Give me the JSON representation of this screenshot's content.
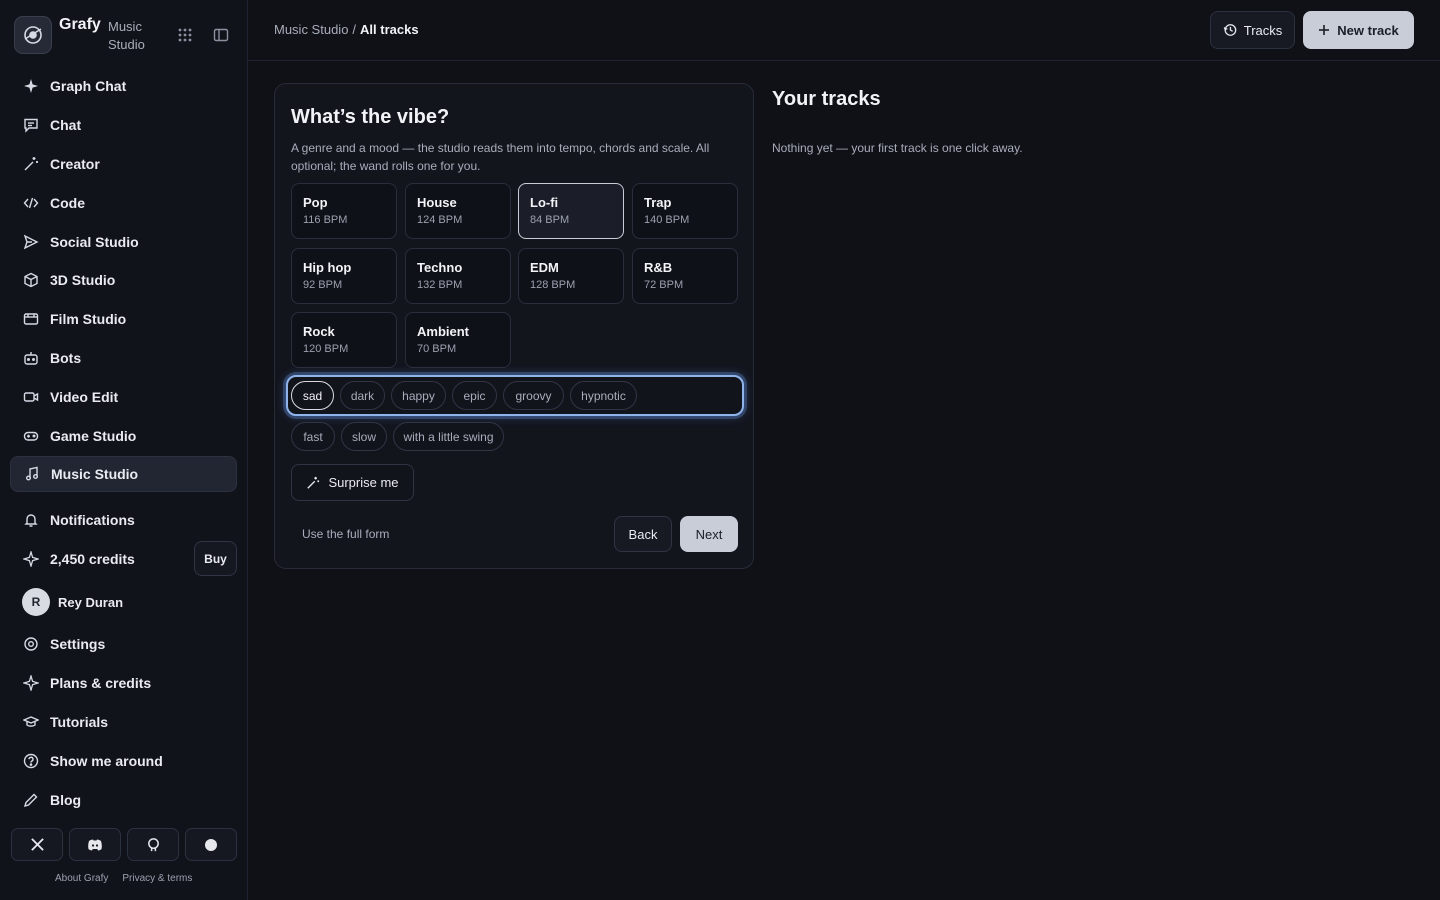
{
  "brand": {
    "name": "Grafy",
    "section": "Music Studio"
  },
  "sidebar": {
    "nav": [
      {
        "label": "Graph Chat",
        "icon": "sparkle-icon"
      },
      {
        "label": "Chat",
        "icon": "chat-icon"
      },
      {
        "label": "Creator",
        "icon": "wand-icon"
      },
      {
        "label": "Code",
        "icon": "code-icon"
      },
      {
        "label": "Social Studio",
        "icon": "send-icon"
      },
      {
        "label": "3D Studio",
        "icon": "cube-icon"
      },
      {
        "label": "Film Studio",
        "icon": "film-icon"
      },
      {
        "label": "Bots",
        "icon": "bot-icon"
      },
      {
        "label": "Video Edit",
        "icon": "video-icon"
      },
      {
        "label": "Game Studio",
        "icon": "gamepad-icon"
      },
      {
        "label": "Music Studio",
        "icon": "music-icon",
        "active": true
      }
    ],
    "notifications": "Notifications",
    "credits": "2,450 credits",
    "buy": "Buy",
    "user": {
      "initial": "R",
      "name": "Rey Duran"
    },
    "bottom": [
      {
        "label": "Settings",
        "icon": "gear-icon"
      },
      {
        "label": "Plans & credits",
        "icon": "sparkle-icon"
      },
      {
        "label": "Tutorials",
        "icon": "graduation-cap-icon"
      },
      {
        "label": "Show me around",
        "icon": "help-circle-icon"
      },
      {
        "label": "Blog",
        "icon": "pencil-icon"
      }
    ],
    "social": [
      "x-icon",
      "discord-icon",
      "github-icon",
      "circle-icon"
    ],
    "footer": {
      "about": "About Grafy",
      "privacy": "Privacy & terms"
    }
  },
  "header": {
    "breadcrumb": {
      "parent": "Music Studio",
      "sep": "/",
      "current": "All tracks"
    },
    "tracks_btn": "Tracks",
    "new_track_btn": "New track"
  },
  "wizard": {
    "title": "What’s the vibe?",
    "description": "A genre and a mood — the studio reads them into tempo, chords and scale. All optional; the wand rolls one for you.",
    "genres": [
      {
        "name": "Pop",
        "bpm": "116 BPM"
      },
      {
        "name": "House",
        "bpm": "124 BPM"
      },
      {
        "name": "Lo-fi",
        "bpm": "84 BPM",
        "selected": true
      },
      {
        "name": "Trap",
        "bpm": "140 BPM"
      },
      {
        "name": "Hip hop",
        "bpm": "92 BPM"
      },
      {
        "name": "Techno",
        "bpm": "132 BPM"
      },
      {
        "name": "EDM",
        "bpm": "128 BPM"
      },
      {
        "name": "R&B",
        "bpm": "72 BPM"
      },
      {
        "name": "Rock",
        "bpm": "120 BPM"
      },
      {
        "name": "Ambient",
        "bpm": "70 BPM"
      }
    ],
    "moods": [
      "sad",
      "dark",
      "happy",
      "epic",
      "groovy",
      "hypnotic"
    ],
    "moods_selected": "sad",
    "tempo_chips": [
      "fast",
      "slow",
      "with a little swing"
    ],
    "surprise": "Surprise me",
    "full_form": "Use the full form",
    "back": "Back",
    "next": "Next"
  },
  "tracks_panel": {
    "title": "Your tracks",
    "empty": "Nothing yet — your first track is one click away."
  },
  "colors": {
    "bg": "#0f1117",
    "accent": "#c9cdd8",
    "focus_ring": "#8fb4ea"
  }
}
